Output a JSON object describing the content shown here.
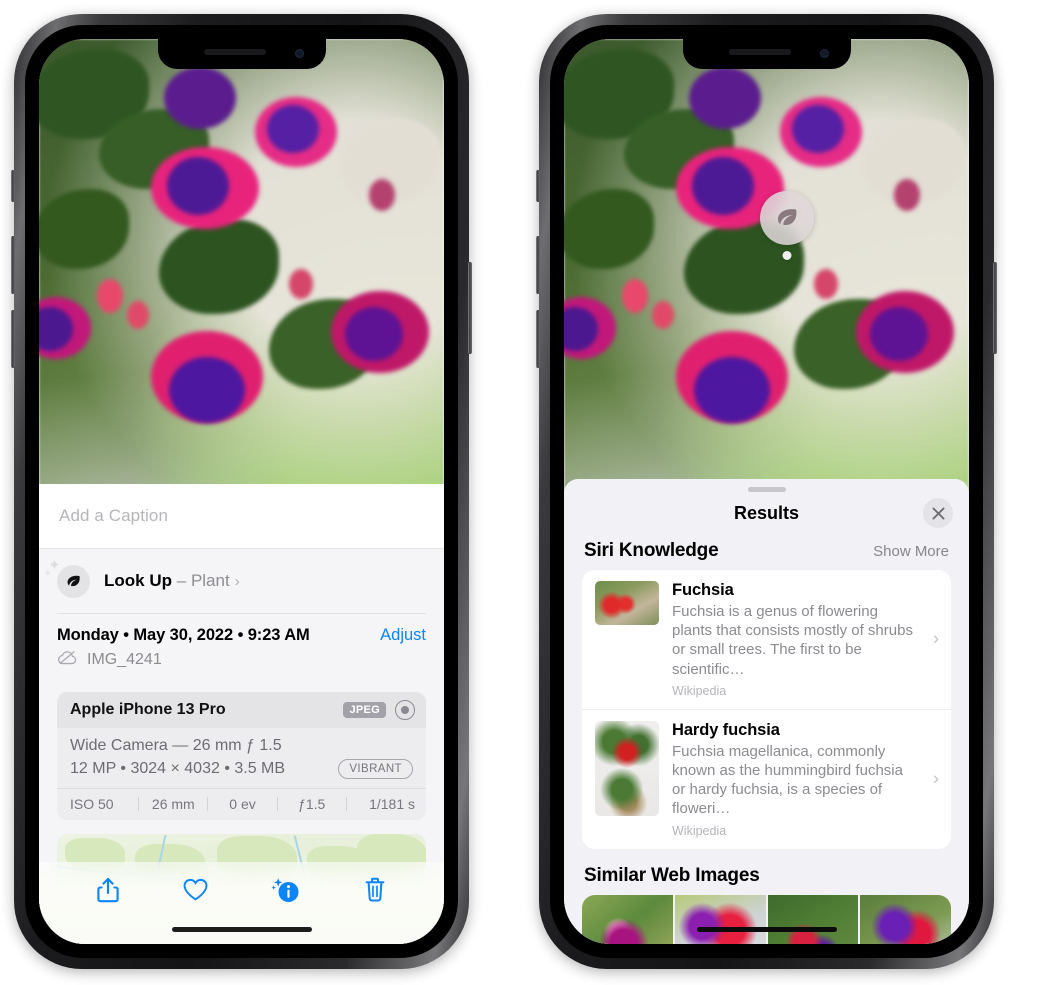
{
  "left_phone": {
    "caption_field": {
      "placeholder": "Add a Caption",
      "value": ""
    },
    "look_up": {
      "label": "Look Up",
      "dash": "–",
      "subject": "Plant",
      "chevron": "›",
      "icon": "leaf-icon"
    },
    "metadata": {
      "date_line": "Monday • May 30, 2022 • 9:23 AM",
      "adjust_label": "Adjust",
      "filename": "IMG_4241",
      "cloud_icon": "icloud-slash-icon"
    },
    "camera_card": {
      "model": "Apple iPhone 13 Pro",
      "format_badge": "JPEG",
      "aperture_icon": "aperture-icon",
      "lens_line": "Wide Camera — 26 mm ƒ 1.5",
      "detail_line": "12 MP • 3024 × 4032 • 3.5 MB",
      "vibrant_badge": "VIBRANT",
      "exif": [
        "ISO 50",
        "26 mm",
        "0 ev",
        "ƒ1.5",
        "1/181 s"
      ]
    },
    "toolbar": [
      {
        "name": "share-button",
        "icon": "share-icon"
      },
      {
        "name": "favorite-button",
        "icon": "heart-icon"
      },
      {
        "name": "info-button",
        "icon": "info-sparkle-icon"
      },
      {
        "name": "delete-button",
        "icon": "trash-icon"
      }
    ],
    "accent_color": "#0a84ff"
  },
  "right_phone": {
    "visual_lookup_badge": {
      "icon": "leaf-icon"
    },
    "sheet": {
      "title": "Results",
      "close_icon": "close-icon",
      "siri_knowledge": {
        "section_title": "Siri Knowledge",
        "show_more": "Show More",
        "items": [
          {
            "title": "Fuchsia",
            "description": "Fuchsia is a genus of flowering plants that consists mostly of shrubs or small trees. The first to be scientific…",
            "source": "Wikipedia",
            "chevron": "›"
          },
          {
            "title": "Hardy fuchsia",
            "description": "Fuchsia magellanica, commonly known as the hummingbird fuchsia or hardy fuchsia, is a species of floweri…",
            "source": "Wikipedia",
            "chevron": "›"
          }
        ]
      },
      "similar_web_images": {
        "section_title": "Similar Web Images",
        "thumbnail_count": 4
      }
    }
  }
}
